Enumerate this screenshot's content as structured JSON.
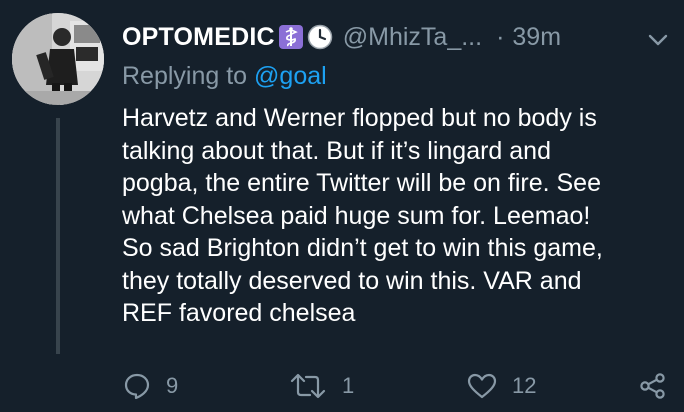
{
  "tweet": {
    "author": {
      "display_name": "OPTOMEDIC",
      "badges": [
        "medical-caduceus-emoji",
        "clock-emoji"
      ],
      "handle": "@MhizTa_...",
      "separator": "·",
      "time": "39m"
    },
    "reply": {
      "prefix": "Replying to ",
      "mention": "@goal"
    },
    "text_lines": [
      "Harvetz and Werner flopped but no body is",
      "talking about that. But if it’s lingard and",
      "pogba, the entire Twitter will be on fire. See",
      "what Chelsea paid huge sum for. Leemao!",
      "So sad Brighton didn’t get to win this game,",
      "they totally deserved to win this. VAR and",
      "REF favored chelsea"
    ],
    "actions": {
      "replies": "9",
      "retweets": "1",
      "likes": "12"
    }
  },
  "colors": {
    "background": "#15202b",
    "secondary_text": "#8899a6",
    "link": "#1da1f2",
    "badge_purple": "#8b6fd6",
    "thread_line": "#38444d"
  }
}
